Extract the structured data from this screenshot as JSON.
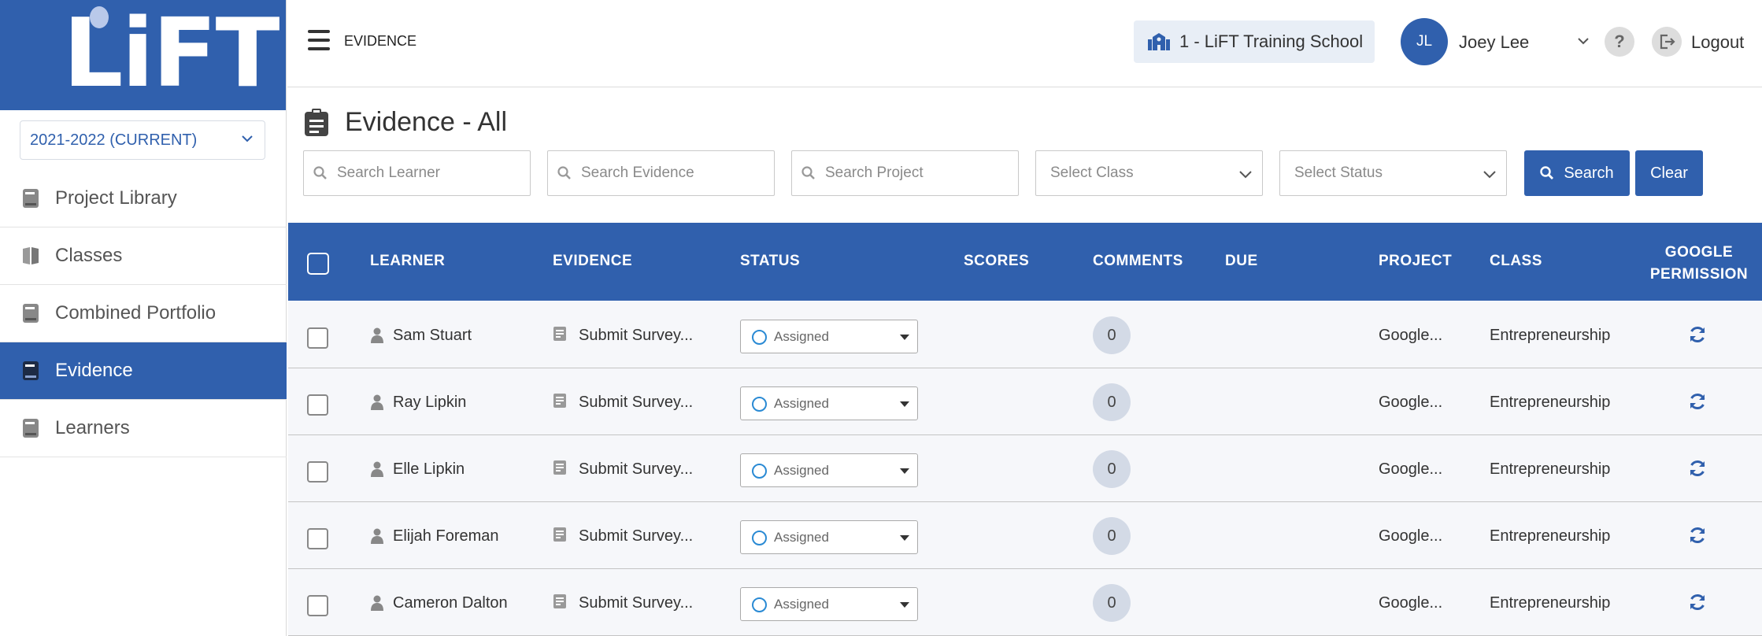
{
  "logo": {
    "text": "LiFT"
  },
  "sidebar": {
    "year": "2021-2022 (CURRENT)",
    "items": [
      {
        "label": "Project Library",
        "icon": "book-icon",
        "active": false
      },
      {
        "label": "Classes",
        "icon": "open-book-icon",
        "active": false
      },
      {
        "label": "Combined Portfolio",
        "icon": "book-icon",
        "active": false
      },
      {
        "label": "Evidence",
        "icon": "book-icon",
        "active": true
      },
      {
        "label": "Learners",
        "icon": "book-icon",
        "active": false
      }
    ]
  },
  "header": {
    "title": "EVIDENCE",
    "school": "1 - LiFT Training School",
    "user_initials": "JL",
    "user_name": "Joey Lee",
    "help": "?",
    "logout": "Logout"
  },
  "page": {
    "title": "Evidence - All"
  },
  "filters": {
    "learner_placeholder": "Search Learner",
    "evidence_placeholder": "Search Evidence",
    "project_placeholder": "Search Project",
    "class_placeholder": "Select Class",
    "status_placeholder": "Select Status",
    "search_label": "Search",
    "clear_label": "Clear"
  },
  "table": {
    "headers": {
      "learner": "LEARNER",
      "evidence": "EVIDENCE",
      "status": "STATUS",
      "scores": "SCORES",
      "comments": "COMMENTS",
      "due": "DUE",
      "project": "PROJECT",
      "class": "CLASS",
      "google_1": "GOOGLE",
      "google_2": "PERMISSION"
    },
    "rows": [
      {
        "learner": "Sam Stuart",
        "evidence": "Submit Survey...",
        "status": "Assigned",
        "comments": "0",
        "project": "Google...",
        "class": "Entrepreneurship"
      },
      {
        "learner": "Ray Lipkin",
        "evidence": "Submit Survey...",
        "status": "Assigned",
        "comments": "0",
        "project": "Google...",
        "class": "Entrepreneurship"
      },
      {
        "learner": "Elle Lipkin",
        "evidence": "Submit Survey...",
        "status": "Assigned",
        "comments": "0",
        "project": "Google...",
        "class": "Entrepreneurship"
      },
      {
        "learner": "Elijah Foreman",
        "evidence": "Submit Survey...",
        "status": "Assigned",
        "comments": "0",
        "project": "Google...",
        "class": "Entrepreneurship"
      },
      {
        "learner": "Cameron Dalton",
        "evidence": "Submit Survey...",
        "status": "Assigned",
        "comments": "0",
        "project": "Google...",
        "class": "Entrepreneurship"
      }
    ]
  },
  "colors": {
    "brand": "#3060ad",
    "status_ring": "#2a8ad4"
  }
}
